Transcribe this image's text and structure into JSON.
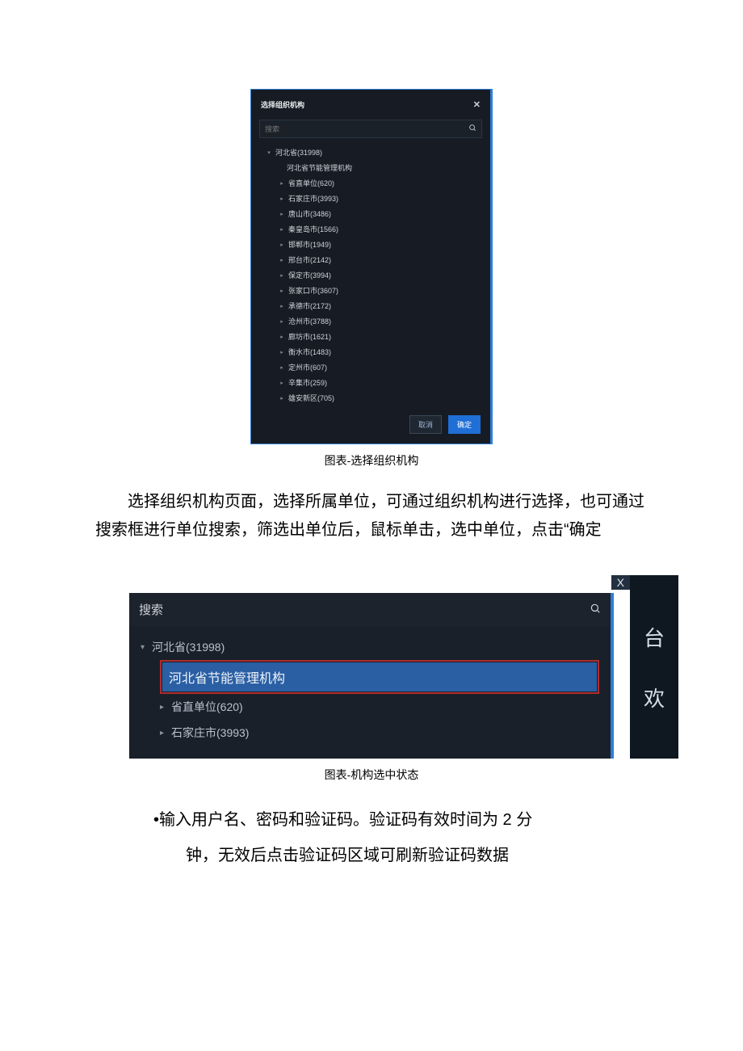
{
  "dialog": {
    "title": "选择组织机构",
    "search_placeholder": "搜索",
    "root": {
      "label": "河北省(31998)"
    },
    "sub_org": "河北省节能管理机构",
    "items": [
      "省直单位(620)",
      "石家庄市(3993)",
      "唐山市(3486)",
      "秦皇岛市(1566)",
      "邯郸市(1949)",
      "邢台市(2142)",
      "保定市(3994)",
      "张家口市(3607)",
      "承德市(2172)",
      "沧州市(3788)",
      "廊坊市(1621)",
      "衡水市(1483)",
      "定州市(607)",
      "辛集市(259)",
      "雄安新区(705)"
    ],
    "cancel": "取消",
    "confirm": "确定"
  },
  "caption1": "图表-选择组织机构",
  "paragraph": "选择组织机构页面，选择所属单位，可通过组织机构进行选择，也可通过搜索框进行单位搜索，筛选出单位后，鼠标单击，选中单位，点击“确定",
  "fig2": {
    "search_placeholder": "搜索",
    "root": "河北省(31998)",
    "selected": "河北省节能管理机构",
    "items": [
      "省直单位(620)",
      "石家庄市(3993)"
    ],
    "close": "X",
    "right_chars": [
      "台",
      "欢"
    ]
  },
  "caption2": "图表-机构选中状态",
  "bullets": {
    "line1": "•输入用户名、密码和验证码。验证码有效时间为 2 分",
    "line2": "钟，无效后点击验证码区域可刷新验证码数据"
  }
}
